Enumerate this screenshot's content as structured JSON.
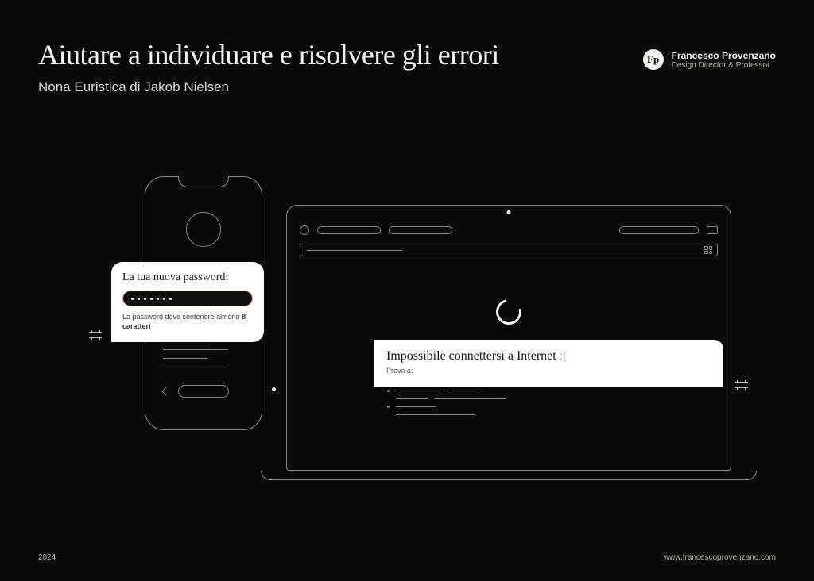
{
  "header": {
    "title": "Aiutare a individuare e risolvere gli errori",
    "subtitle": "Nona Euristica di Jakob Nielsen"
  },
  "author": {
    "logo_text": "Fp",
    "name": "Francesco Provenzano",
    "role": "Design Director & Professor"
  },
  "password_card": {
    "title": "La tua nuova password:",
    "hint_prefix": "La password deve contenere almeno ",
    "hint_bold": "8 caratteri"
  },
  "network_card": {
    "title_text": "Impossibile connettersi a Internet ",
    "title_emoji": ":(",
    "subtitle": "Prova a:"
  },
  "footer": {
    "year": "2024",
    "url": "www.francescoprovenzano.com"
  }
}
